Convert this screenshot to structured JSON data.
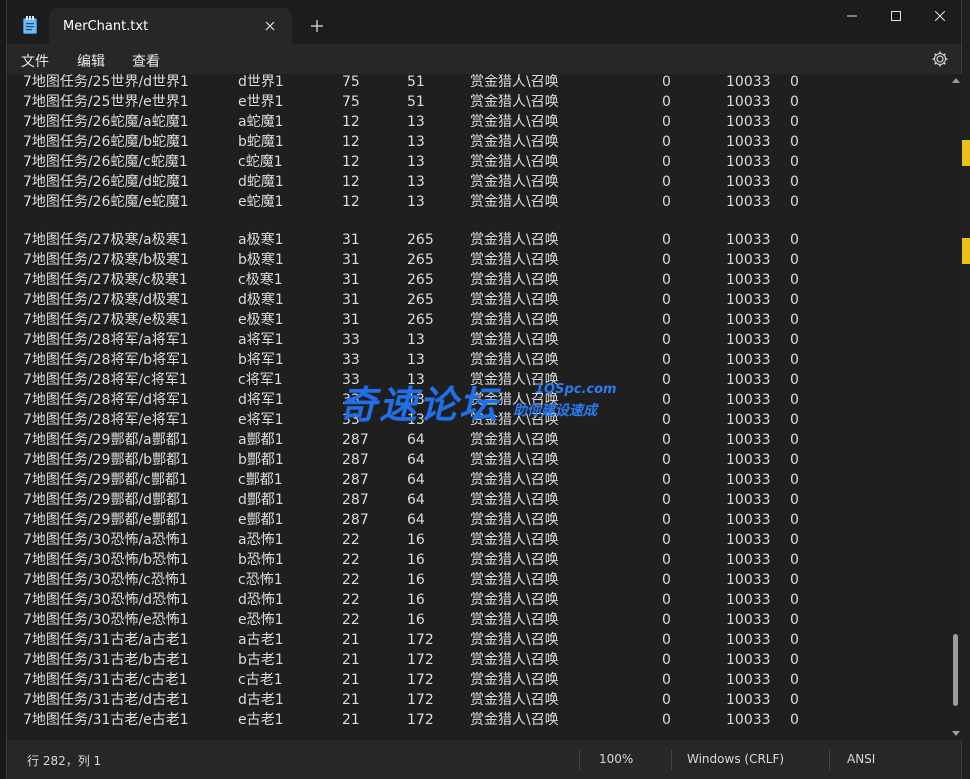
{
  "window": {
    "tab_title": "MerChant.txt",
    "menu": [
      "文件",
      "编辑",
      "查看"
    ]
  },
  "editor": {
    "lines_a": [
      [
        "7地图任务/25世界/d世界1",
        "d世界1",
        "75",
        "51",
        "赏金猎人\\召唤",
        "0",
        "10033",
        "0"
      ],
      [
        "7地图任务/25世界/e世界1",
        "e世界1",
        "75",
        "51",
        "赏金猎人\\召唤",
        "0",
        "10033",
        "0"
      ],
      [
        "7地图任务/26蛇魔/a蛇魔1",
        "a蛇魔1",
        "12",
        "13",
        "赏金猎人\\召唤",
        "0",
        "10033",
        "0"
      ],
      [
        "7地图任务/26蛇魔/b蛇魔1",
        "b蛇魔1",
        "12",
        "13",
        "赏金猎人\\召唤",
        "0",
        "10033",
        "0"
      ],
      [
        "7地图任务/26蛇魔/c蛇魔1",
        "c蛇魔1",
        "12",
        "13",
        "赏金猎人\\召唤",
        "0",
        "10033",
        "0"
      ],
      [
        "7地图任务/26蛇魔/d蛇魔1",
        "d蛇魔1",
        "12",
        "13",
        "赏金猎人\\召唤",
        "0",
        "10033",
        "0"
      ],
      [
        "7地图任务/26蛇魔/e蛇魔1",
        "e蛇魔1",
        "12",
        "13",
        "赏金猎人\\召唤",
        "0",
        "10033",
        "0"
      ]
    ],
    "lines_b": [
      [
        "7地图任务/27极寒/a极寒1",
        "a极寒1",
        "31",
        "265",
        "赏金猎人\\召唤",
        "0",
        "10033",
        "0"
      ],
      [
        "7地图任务/27极寒/b极寒1",
        "b极寒1",
        "31",
        "265",
        "赏金猎人\\召唤",
        "0",
        "10033",
        "0"
      ],
      [
        "7地图任务/27极寒/c极寒1",
        "c极寒1",
        "31",
        "265",
        "赏金猎人\\召唤",
        "0",
        "10033",
        "0"
      ],
      [
        "7地图任务/27极寒/d极寒1",
        "d极寒1",
        "31",
        "265",
        "赏金猎人\\召唤",
        "0",
        "10033",
        "0"
      ],
      [
        "7地图任务/27极寒/e极寒1",
        "e极寒1",
        "31",
        "265",
        "赏金猎人\\召唤",
        "0",
        "10033",
        "0"
      ],
      [
        "7地图任务/28将军/a将军1",
        "a将军1",
        "33",
        "13",
        "赏金猎人\\召唤",
        "0",
        "10033",
        "0"
      ],
      [
        "7地图任务/28将军/b将军1",
        "b将军1",
        "33",
        "13",
        "赏金猎人\\召唤",
        "0",
        "10033",
        "0"
      ],
      [
        "7地图任务/28将军/c将军1",
        "c将军1",
        "33",
        "13",
        "赏金猎人\\召唤",
        "0",
        "10033",
        "0"
      ],
      [
        "7地图任务/28将军/d将军1",
        "d将军1",
        "33",
        "13",
        "赏金猎人\\召唤",
        "0",
        "10033",
        "0"
      ],
      [
        "7地图任务/28将军/e将军1",
        "e将军1",
        "33",
        "13",
        "赏金猎人\\召唤",
        "0",
        "10033",
        "0"
      ],
      [
        "7地图任务/29酆都/a酆都1",
        "a酆都1",
        "287",
        "64",
        "赏金猎人\\召唤",
        "0",
        "10033",
        "0"
      ],
      [
        "7地图任务/29酆都/b酆都1",
        "b酆都1",
        "287",
        "64",
        "赏金猎人\\召唤",
        "0",
        "10033",
        "0"
      ],
      [
        "7地图任务/29酆都/c酆都1",
        "c酆都1",
        "287",
        "64",
        "赏金猎人\\召唤",
        "0",
        "10033",
        "0"
      ],
      [
        "7地图任务/29酆都/d酆都1",
        "d酆都1",
        "287",
        "64",
        "赏金猎人\\召唤",
        "0",
        "10033",
        "0"
      ],
      [
        "7地图任务/29酆都/e酆都1",
        "e酆都1",
        "287",
        "64",
        "赏金猎人\\召唤",
        "0",
        "10033",
        "0"
      ],
      [
        "7地图任务/30恐怖/a恐怖1",
        "a恐怖1",
        "22",
        "16",
        "赏金猎人\\召唤",
        "0",
        "10033",
        "0"
      ],
      [
        "7地图任务/30恐怖/b恐怖1",
        "b恐怖1",
        "22",
        "16",
        "赏金猎人\\召唤",
        "0",
        "10033",
        "0"
      ],
      [
        "7地图任务/30恐怖/c恐怖1",
        "c恐怖1",
        "22",
        "16",
        "赏金猎人\\召唤",
        "0",
        "10033",
        "0"
      ],
      [
        "7地图任务/30恐怖/d恐怖1",
        "d恐怖1",
        "22",
        "16",
        "赏金猎人\\召唤",
        "0",
        "10033",
        "0"
      ],
      [
        "7地图任务/30恐怖/e恐怖1",
        "e恐怖1",
        "22",
        "16",
        "赏金猎人\\召唤",
        "0",
        "10033",
        "0"
      ],
      [
        "7地图任务/31古老/a古老1",
        "a古老1",
        "21",
        "172",
        "赏金猎人\\召唤",
        "0",
        "10033",
        "0"
      ],
      [
        "7地图任务/31古老/b古老1",
        "b古老1",
        "21",
        "172",
        "赏金猎人\\召唤",
        "0",
        "10033",
        "0"
      ],
      [
        "7地图任务/31古老/c古老1",
        "c古老1",
        "21",
        "172",
        "赏金猎人\\召唤",
        "0",
        "10033",
        "0"
      ],
      [
        "7地图任务/31古老/d古老1",
        "d古老1",
        "21",
        "172",
        "赏金猎人\\召唤",
        "0",
        "10033",
        "0"
      ],
      [
        "7地图任务/31古老/e古老1",
        "e古老1",
        "21",
        "172",
        "赏金猎人\\召唤",
        "0",
        "10033",
        "0"
      ]
    ]
  },
  "status": {
    "position": "行 282，列 1",
    "zoom": "100%",
    "line_ending": "Windows (CRLF)",
    "encoding": "ANSI"
  },
  "watermark": {
    "name": "奇速论坛",
    "url": "1QSpc.com",
    "slogan": "助你建设速成"
  },
  "icons": {
    "app": "notepad-icon",
    "close": "close-icon",
    "new_tab": "plus-icon",
    "settings": "gear-icon"
  },
  "colors": {
    "background": "#1f1f1f",
    "text": "#dcdcdc",
    "watermark": "#1e6fe8"
  }
}
